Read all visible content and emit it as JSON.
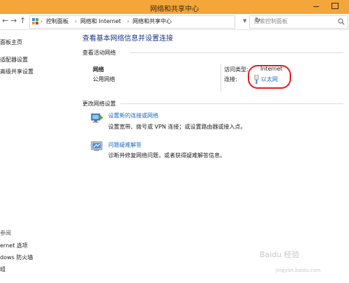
{
  "window": {
    "title": "网络和共享中心"
  },
  "address_bar": {
    "back": "←",
    "forward": "→",
    "up": "↑",
    "crumbs": [
      "控制面板",
      "网络和 Internet",
      "网络和共享中心"
    ],
    "separator": "›",
    "search_placeholder": "搜索控制面板"
  },
  "sidebar": {
    "items": [
      "面板主页",
      "适配器设置",
      "高级共享设置"
    ],
    "see_also_label": "参阅",
    "see_also_items": [
      "ernet 选项",
      "dows 防火墙",
      "组"
    ]
  },
  "main": {
    "title": "查看基本网络信息并设置连接",
    "active_networks_heading": "查看活动网络",
    "network": {
      "name": "网络",
      "type": "公用网络",
      "access_type_label": "访问类型:",
      "access_type_value": "Internet",
      "connections_label": "连接:",
      "connection_name": "以太网"
    },
    "change_settings_heading": "更改网络设置",
    "tasks": [
      {
        "link": "设置新的连接或网络",
        "desc": "设置宽带、拨号或 VPN 连接；或设置路由器或接入点。",
        "icon": "network-setup-icon"
      },
      {
        "link": "问题疑难解答",
        "desc": "诊断并修复网络问题，或者获得疑难解答信息。",
        "icon": "troubleshoot-icon"
      }
    ]
  },
  "colors": {
    "titlebar": "#f4a63a",
    "link": "#1a6ac0",
    "title": "#1e3287",
    "annotation": "#e8191d"
  },
  "watermark": {
    "text": "Baidu 经验",
    "url": "jingyan.baidu.com"
  }
}
